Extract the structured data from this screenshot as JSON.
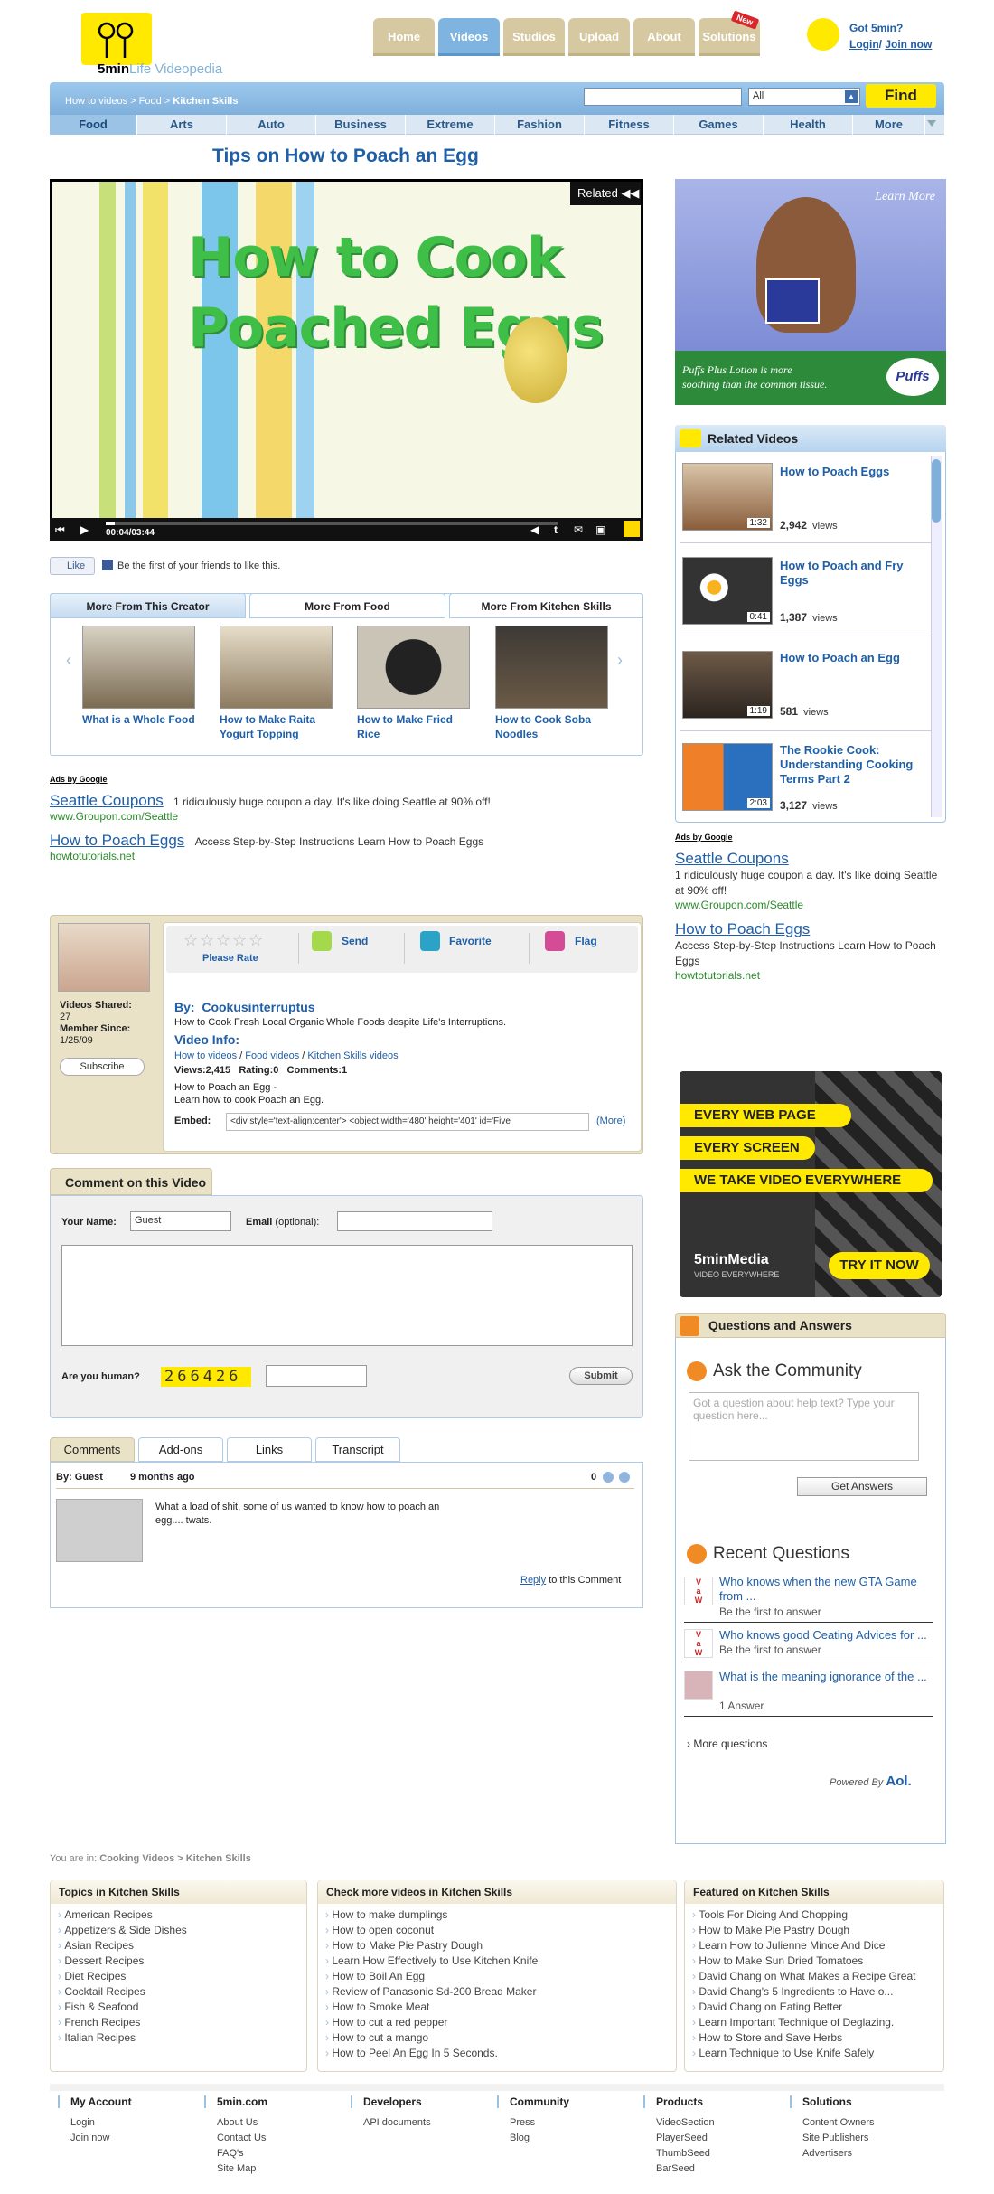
{
  "header": {
    "logo_text": "5min",
    "logo_sub": "Life Videopedia",
    "nav": [
      "Home",
      "Videos",
      "Studios",
      "Upload",
      "About",
      "Solutions"
    ],
    "new_badge": "New",
    "got5min": "Got 5min?",
    "login": "Login",
    "join": "Join now"
  },
  "breadcrumb": {
    "home": "How to videos",
    "sep": ">",
    "food": "Food",
    "current": "Kitchen Skills"
  },
  "search": {
    "select_value": "All",
    "find_label": "Find"
  },
  "categories": [
    "Food",
    "Arts",
    "Auto",
    "Business",
    "Extreme",
    "Fashion",
    "Fitness",
    "Games",
    "Health",
    "More"
  ],
  "video": {
    "title": "Tips on How to Poach an Egg",
    "frame_text_1": "How to Cook",
    "frame_text_2": "Poached Eggs",
    "related_label": "Related",
    "timecode": "00:04/03:44",
    "progress_fraction": 0.02
  },
  "like": {
    "button": "Like",
    "text": "Be the first of your friends to like this."
  },
  "more_from": {
    "tabs": [
      "More From This Creator",
      "More From Food",
      "More From Kitchen Skills"
    ],
    "items": [
      "What is a Whole Food",
      "How to Make Raita Yogurt Topping",
      "How to Make Fried Rice",
      "How to Cook Soba Noodles"
    ]
  },
  "ads_left": {
    "ads_by": "Ads by Google",
    "items": [
      {
        "title": "Seattle Coupons",
        "desc": "1 ridiculously huge coupon a day. It's like doing Seattle at 90% off!",
        "url": "www.Groupon.com/Seattle"
      },
      {
        "title": "How to Poach Eggs",
        "desc": "Access Step-by-Step Instructions Learn How to Poach Eggs",
        "url": "howtotutorials.net"
      }
    ]
  },
  "creator": {
    "videos_shared_label": "Videos Shared:",
    "videos_shared": "27",
    "member_since_label": "Member Since:",
    "member_since": "1/25/09",
    "subscribe": "Subscribe",
    "please_rate": "Please Rate",
    "send": "Send",
    "favorite": "Favorite",
    "flag": "Flag",
    "by_label": "By:",
    "name": "Cookusinterruptus",
    "tagline": "How to Cook Fresh Local Organic Whole Foods despite Life's Interruptions.",
    "video_info": "Video Info:",
    "info_links": [
      "How to videos",
      "Food videos",
      "Kitchen Skills videos"
    ],
    "stats": "Views:2,415   Rating:0   Comments:1",
    "desc_1": "How to Poach an Egg -",
    "desc_2": "Learn how to cook Poach an Egg.",
    "embed_label": "Embed:",
    "embed_value": "<div style='text-align:center'> <object width='480' height='401' id='Five",
    "more": "(More)"
  },
  "comment_form": {
    "tab": "Comment on this Video",
    "name_label": "Your Name:",
    "name_value": "Guest",
    "email_label": "Email",
    "email_opt": "(optional):",
    "human_label": "Are you human?",
    "captcha": "266426",
    "submit": "Submit"
  },
  "comments": {
    "tabs": [
      "Comments",
      "Add-ons",
      "Links",
      "Transcript"
    ],
    "by": "By: Guest",
    "when": "9 months ago",
    "score": "0",
    "text": "What a load of shit, some of us wanted to know how to poach an egg.... twats.",
    "reply": "Reply",
    "reply_suffix": "to this Comment"
  },
  "related_videos": {
    "heading": "Related Videos",
    "items": [
      {
        "title": "How to Poach Eggs",
        "views": "2,942",
        "dur": "1:32"
      },
      {
        "title": "How to Poach and Fry Eggs",
        "views": "1,387",
        "dur": "0:41"
      },
      {
        "title": "How to Poach an Egg",
        "views": "581",
        "dur": "1:19"
      },
      {
        "title": "The Rookie Cook: Understanding Cooking Terms Part 2",
        "views": "3,127",
        "dur": "2:03"
      }
    ],
    "views_label": "views"
  },
  "ads_right": {
    "ads_by": "Ads by Google",
    "items": [
      {
        "title": "Seattle Coupons",
        "desc": "1 ridiculously huge coupon a day. It's like doing Seattle at 90% off!",
        "url": "www.Groupon.com/Seattle"
      },
      {
        "title": "How to Poach Eggs",
        "desc": "Access Step-by-Step Instructions Learn How to Poach Eggs",
        "url": "howtotutorials.net"
      }
    ]
  },
  "puffs_ad": {
    "learn_more": "Learn More",
    "line1": "Puffs Plus Lotion is more",
    "line2": "soothing than the common tissue.",
    "brand": "Puffs"
  },
  "fivemin_ad": {
    "bands": [
      "EVERY WEB PAGE",
      "EVERY SCREEN",
      "WE TAKE VIDEO EVERYWHERE"
    ],
    "brand": "5minMedia",
    "brand_sub": "VIDEO EVERYWHERE",
    "cta": "TRY IT NOW"
  },
  "qa": {
    "heading": "Questions and Answers",
    "ask": "Ask the Community",
    "placeholder": "Got a question  about help text? Type your question here...",
    "get_answers": "Get Answers",
    "recent": "Recent Questions",
    "items": [
      {
        "q": "Who knows when the new GTA Game from ...",
        "a": "Be the first to answer"
      },
      {
        "q": "Who knows good Ceating Advices for ...",
        "a": "Be the first to answer"
      },
      {
        "q": "What is the meaning ignorance of the ...",
        "a": "1 Answer"
      }
    ],
    "more": "More questions",
    "powered": "Powered By",
    "aol": "Aol."
  },
  "footer": {
    "you_are_in": "You are in:",
    "crumb": "Cooking Videos > Kitchen Skills",
    "topics_head": "Topics in Kitchen Skills",
    "topics": [
      "American Recipes",
      "Appetizers & Side Dishes",
      "Asian Recipes",
      "Dessert Recipes",
      "Diet Recipes",
      "Cocktail Recipes",
      "Fish & Seafood",
      "French Recipes",
      "Italian Recipes"
    ],
    "more_head": "Check more videos in Kitchen Skills",
    "more": [
      "How to make dumplings",
      "How to open coconut",
      "How to Make Pie Pastry Dough",
      "Learn How Effectively to Use Kitchen Knife",
      "How to Boil An Egg",
      "Review of Panasonic Sd-200 Bread Maker",
      "How to Smoke Meat",
      "How to cut a red pepper",
      "How to cut a mango",
      "How to Peel An Egg In 5 Seconds."
    ],
    "featured_head": "Featured on Kitchen Skills",
    "featured": [
      "Tools For Dicing And Chopping",
      "How to Make Pie Pastry Dough",
      "Learn How to Julienne Mince And Dice",
      "How to Make Sun Dried Tomatoes",
      "David Chang on What Makes a Recipe Great",
      "David Chang's 5 Ingredients to Have o...",
      "David Chang on Eating Better",
      "Learn Important Technique of Deglazing.",
      "How to Store and Save Herbs",
      "Learn Technique to Use Knife Safely"
    ],
    "cols": [
      {
        "head": "My Account",
        "links": [
          "Login",
          "Join now"
        ]
      },
      {
        "head": "5min.com",
        "links": [
          "About Us",
          "Contact Us",
          "FAQ's",
          "Site Map"
        ]
      },
      {
        "head": "Developers",
        "links": [
          "API documents"
        ]
      },
      {
        "head": "Community",
        "links": [
          "Press",
          "Blog"
        ]
      },
      {
        "head": "Products",
        "links": [
          "VideoSection",
          "PlayerSeed",
          "ThumbSeed",
          "BarSeed"
        ]
      },
      {
        "head": "Solutions",
        "links": [
          "Content Owners",
          "Site Publishers",
          "Advertisers"
        ]
      }
    ]
  }
}
